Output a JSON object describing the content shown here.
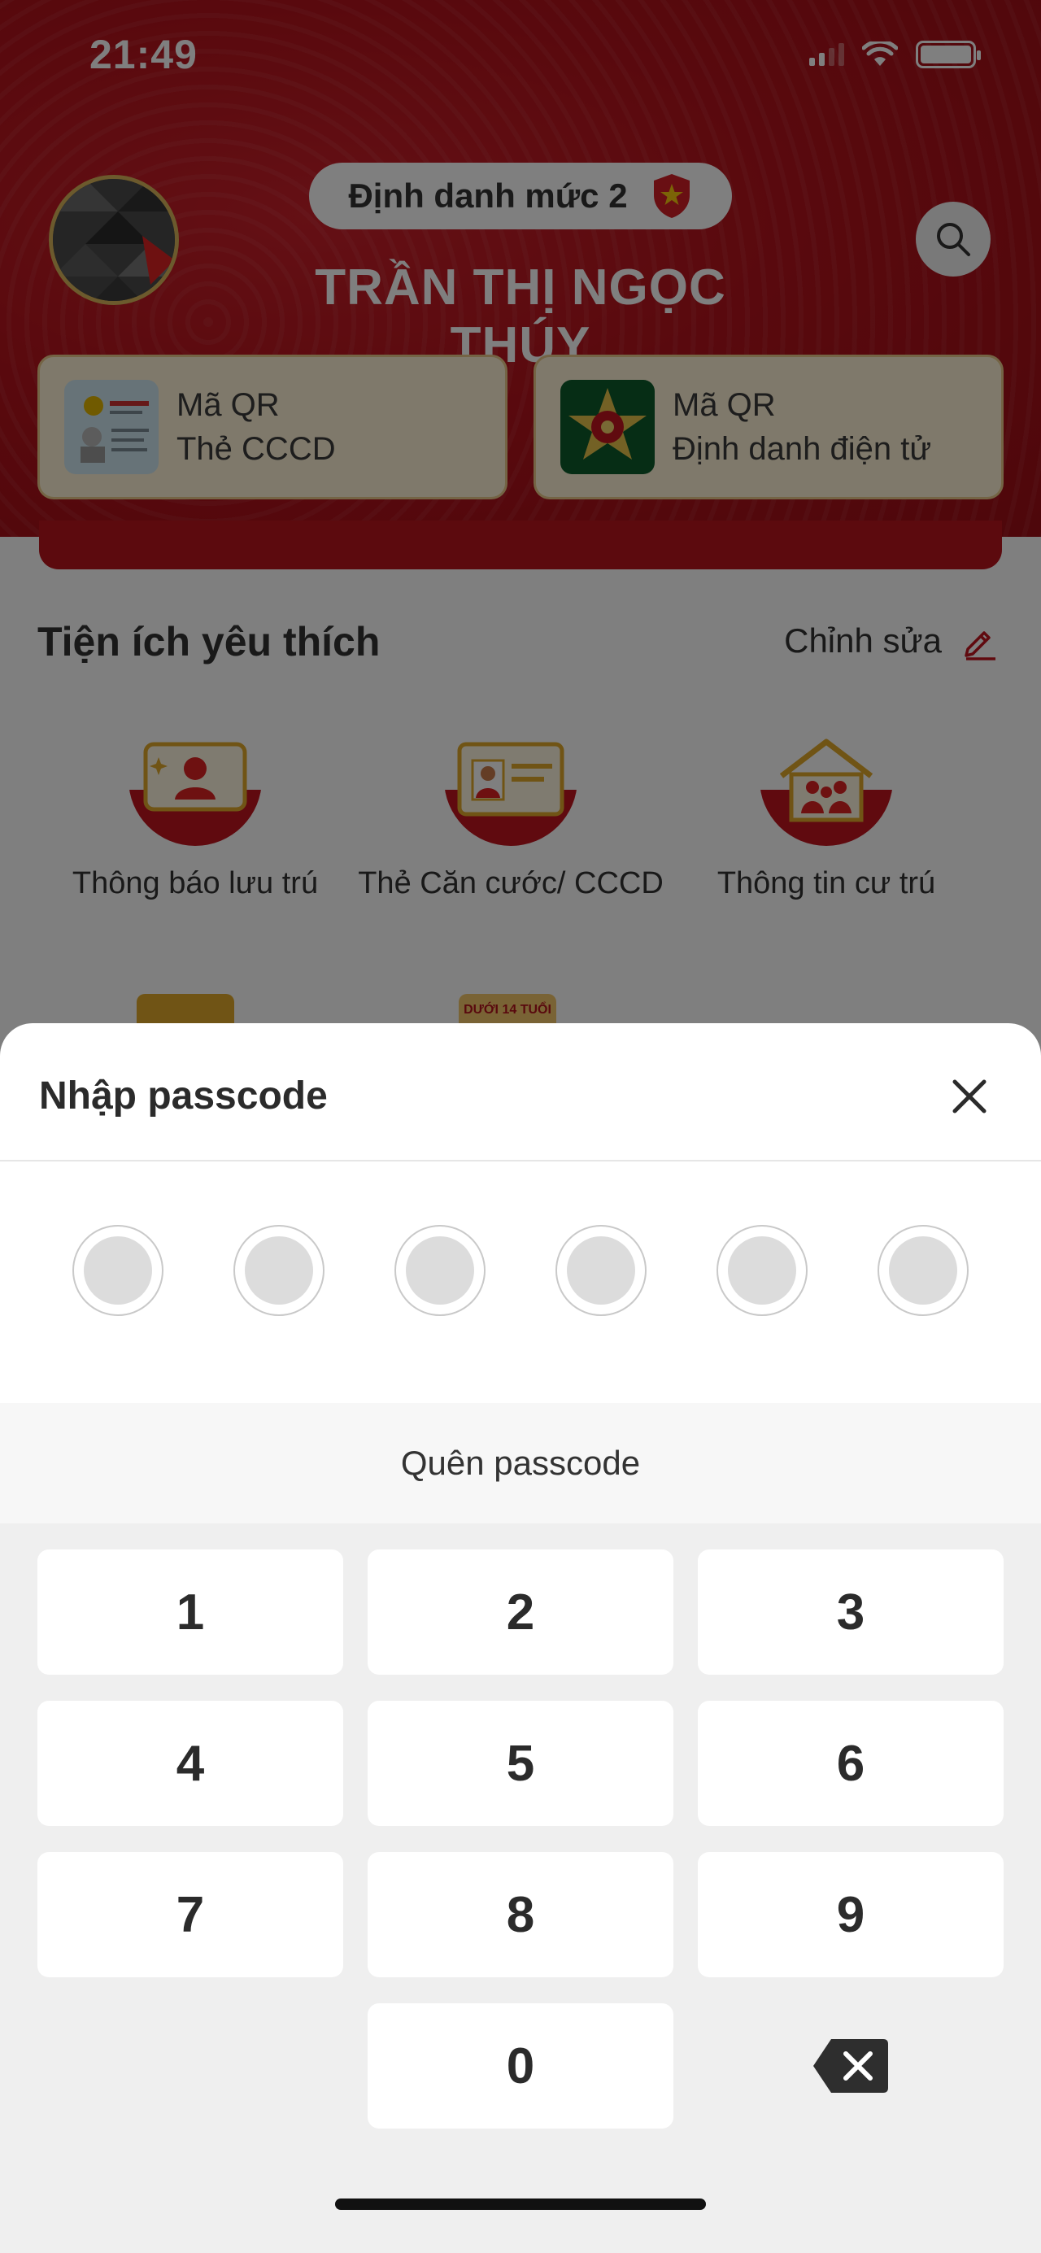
{
  "status_bar": {
    "time": "21:49"
  },
  "profile": {
    "level_label": "Định danh mức 2",
    "name": "TRẦN THỊ NGỌC THÚY"
  },
  "qr_cards": [
    {
      "line1": "Mã QR",
      "line2": "Thẻ CCCD",
      "icon": "id-card-icon"
    },
    {
      "line1": "Mã QR",
      "line2": "Định danh điện tử",
      "icon": "police-emblem-icon"
    }
  ],
  "favorites": {
    "title": "Tiện ích yêu thích",
    "edit_label": "Chỉnh sửa",
    "items": [
      {
        "label": "Thông báo lưu trú",
        "icon": "notification-person-icon"
      },
      {
        "label": "Thẻ Căn cước/ CCCD",
        "icon": "id-card-icon"
      },
      {
        "label": "Thông tin cư trú",
        "icon": "house-family-icon"
      }
    ],
    "peek_badge": "DƯỚI 14 TUỔI"
  },
  "passcode_sheet": {
    "title": "Nhập passcode",
    "digits_total": 6,
    "digits_filled": 0,
    "forgot_label": "Quên passcode",
    "keys": [
      "1",
      "2",
      "3",
      "4",
      "5",
      "6",
      "7",
      "8",
      "9",
      "0"
    ]
  },
  "colors": {
    "brand_red": "#b8141d",
    "card_bg": "#fff3d6",
    "keypad_bg": "#efefef"
  }
}
